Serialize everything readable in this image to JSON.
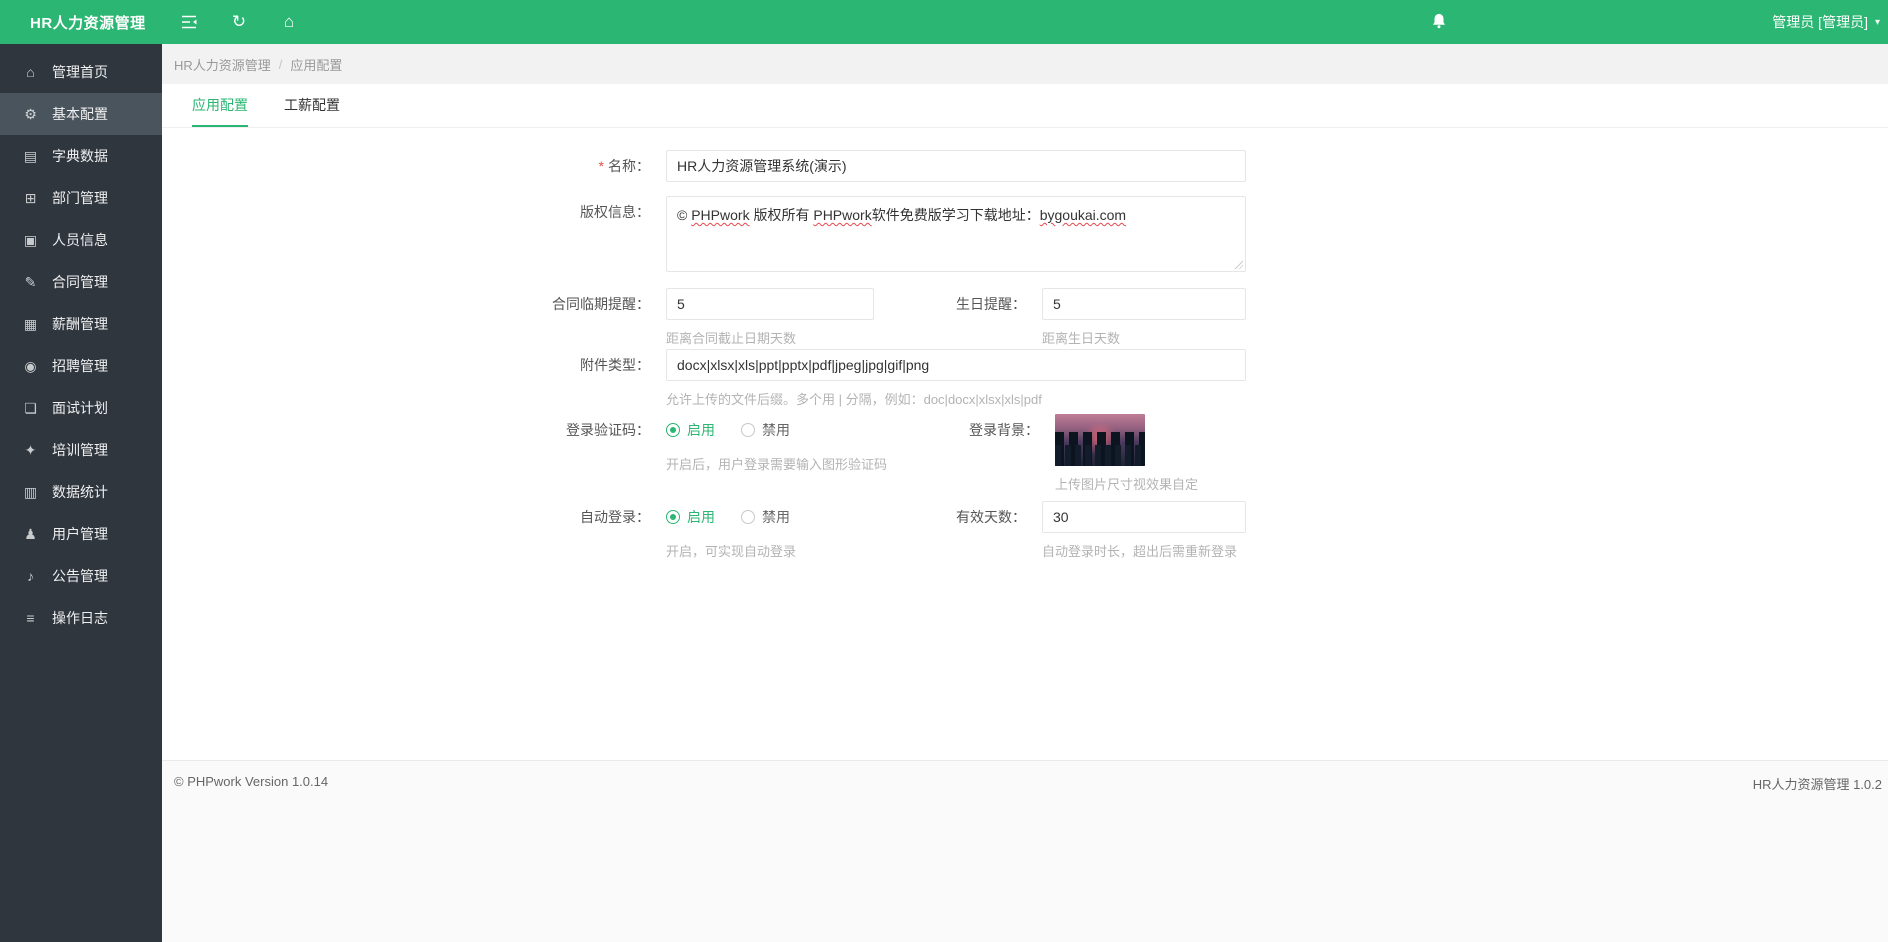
{
  "header": {
    "logo": "HR人力资源管理",
    "user": "管理员 [管理员]",
    "caret": "▾"
  },
  "breadcrumb": {
    "root": "HR人力资源管理",
    "separator": "/",
    "current": "应用配置"
  },
  "tabs": {
    "app_config": "应用配置",
    "salary_config": "工薪配置"
  },
  "sidebar": {
    "items": [
      {
        "label": "管理首页",
        "icon": "home-icon"
      },
      {
        "label": "基本配置",
        "icon": "gear-icon",
        "active": true
      },
      {
        "label": "字典数据",
        "icon": "book-icon"
      },
      {
        "label": "部门管理",
        "icon": "org-chart-icon"
      },
      {
        "label": "人员信息",
        "icon": "id-card-icon"
      },
      {
        "label": "合同管理",
        "icon": "pencil-icon"
      },
      {
        "label": "薪酬管理",
        "icon": "calculator-icon"
      },
      {
        "label": "招聘管理",
        "icon": "target-icon"
      },
      {
        "label": "面试计划",
        "icon": "document-icon"
      },
      {
        "label": "培训管理",
        "icon": "training-icon"
      },
      {
        "label": "数据统计",
        "icon": "chart-icon"
      },
      {
        "label": "用户管理",
        "icon": "user-icon"
      },
      {
        "label": "公告管理",
        "icon": "speaker-icon"
      },
      {
        "label": "操作日志",
        "icon": "log-icon"
      }
    ]
  },
  "form": {
    "name": {
      "required_mark": "*",
      "label": "名称：",
      "value": "HR人力资源管理系统(演示)"
    },
    "copyright": {
      "label": "版权信息：",
      "segments": [
        {
          "text": "© ",
          "squiggle": false
        },
        {
          "text": "PHPwork",
          "squiggle": true
        },
        {
          "text": " 版权所有 ",
          "squiggle": false
        },
        {
          "text": "PHPwork",
          "squiggle": true
        },
        {
          "text": "软件免费版学习下载地址：",
          "squiggle": false
        },
        {
          "text": "bygoukai.com",
          "squiggle": true
        }
      ]
    },
    "contract_reminder": {
      "label": "合同临期提醒：",
      "value": "5",
      "help": "距离合同截止日期天数"
    },
    "birthday_reminder": {
      "label": "生日提醒：",
      "value": "5",
      "help": "距离生日天数"
    },
    "attachment": {
      "label": "附件类型：",
      "value": "docx|xlsx|xls|ppt|pptx|pdf|jpeg|jpg|gif|png",
      "help": "允许上传的文件后缀。多个用 | 分隔，例如：doc|docx|xlsx|xls|pdf"
    },
    "captcha": {
      "label": "登录验证码：",
      "enable": "启用",
      "disable": "禁用",
      "selected": "启用",
      "help": "开启后，用户登录需要输入图形验证码"
    },
    "login_bg": {
      "label": "登录背景：",
      "help": "上传图片尺寸视效果自定"
    },
    "auto_login": {
      "label": "自动登录：",
      "enable": "启用",
      "disable": "禁用",
      "selected": "启用",
      "help": "开启，可实现自动登录"
    },
    "valid_days": {
      "label": "有效天数：",
      "value": "30",
      "help": "自动登录时长，超出后需重新登录"
    }
  },
  "footer": {
    "left": "© PHPwork Version 1.0.14",
    "right": "HR人力资源管理 1.0.2"
  },
  "colors": {
    "accent": "#2BB673",
    "sidebar_bg": "#2F363E",
    "sidebar_active": "#4A545C",
    "help_text": "#B3B3B3",
    "required": "#E54D42"
  }
}
